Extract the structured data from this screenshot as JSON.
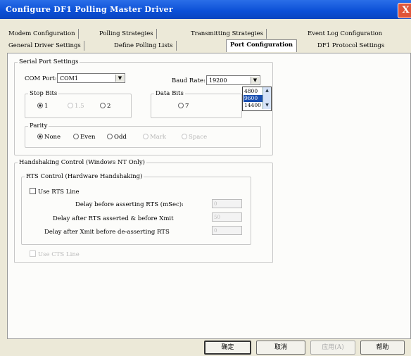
{
  "window": {
    "title": "Configure DF1 Polling Master Driver",
    "close_label": "X"
  },
  "tabs_row1": [
    "Modem Configuration",
    "Polling Strategies",
    "Transmitting Strategies",
    "Event Log Configuration"
  ],
  "tabs_row2": [
    "General Driver Settings",
    "Define Polling Lists",
    "Port Configuration",
    "DF1 Protocol Settings"
  ],
  "serial": {
    "legend": "Serial Port Settings",
    "com_label": "COM Port:",
    "com_value": "COM1",
    "baud_label": "Baud Rate:",
    "baud_value": "19200",
    "baud_options": [
      "4800",
      "9600",
      "14400"
    ],
    "stop_legend": "Stop Bits",
    "stop_options": [
      "1",
      "1.5",
      "2"
    ],
    "data_legend": "Data Bits",
    "data_option": "7",
    "parity_legend": "Parity",
    "parity_options": [
      "None",
      "Even",
      "Odd",
      "Mark",
      "Space"
    ]
  },
  "handshake": {
    "legend": "Handshaking Control (Windows NT Only)",
    "rts_legend": "RTS Control (Hardware Handshaking)",
    "use_rts": "Use RTS Line",
    "delay1_label": "Delay before asserting RTS (mSec):",
    "delay1_value": "0",
    "delay2_label": "Delay after RTS asserted & before Xmit",
    "delay2_value": "50",
    "delay3_label": "Delay after Xmit before de-asserting RTS",
    "delay3_value": "0",
    "use_cts": "Use CTS Line"
  },
  "buttons": {
    "ok": "确定",
    "cancel": "取消",
    "apply": "应用(A)",
    "help": "帮助"
  }
}
